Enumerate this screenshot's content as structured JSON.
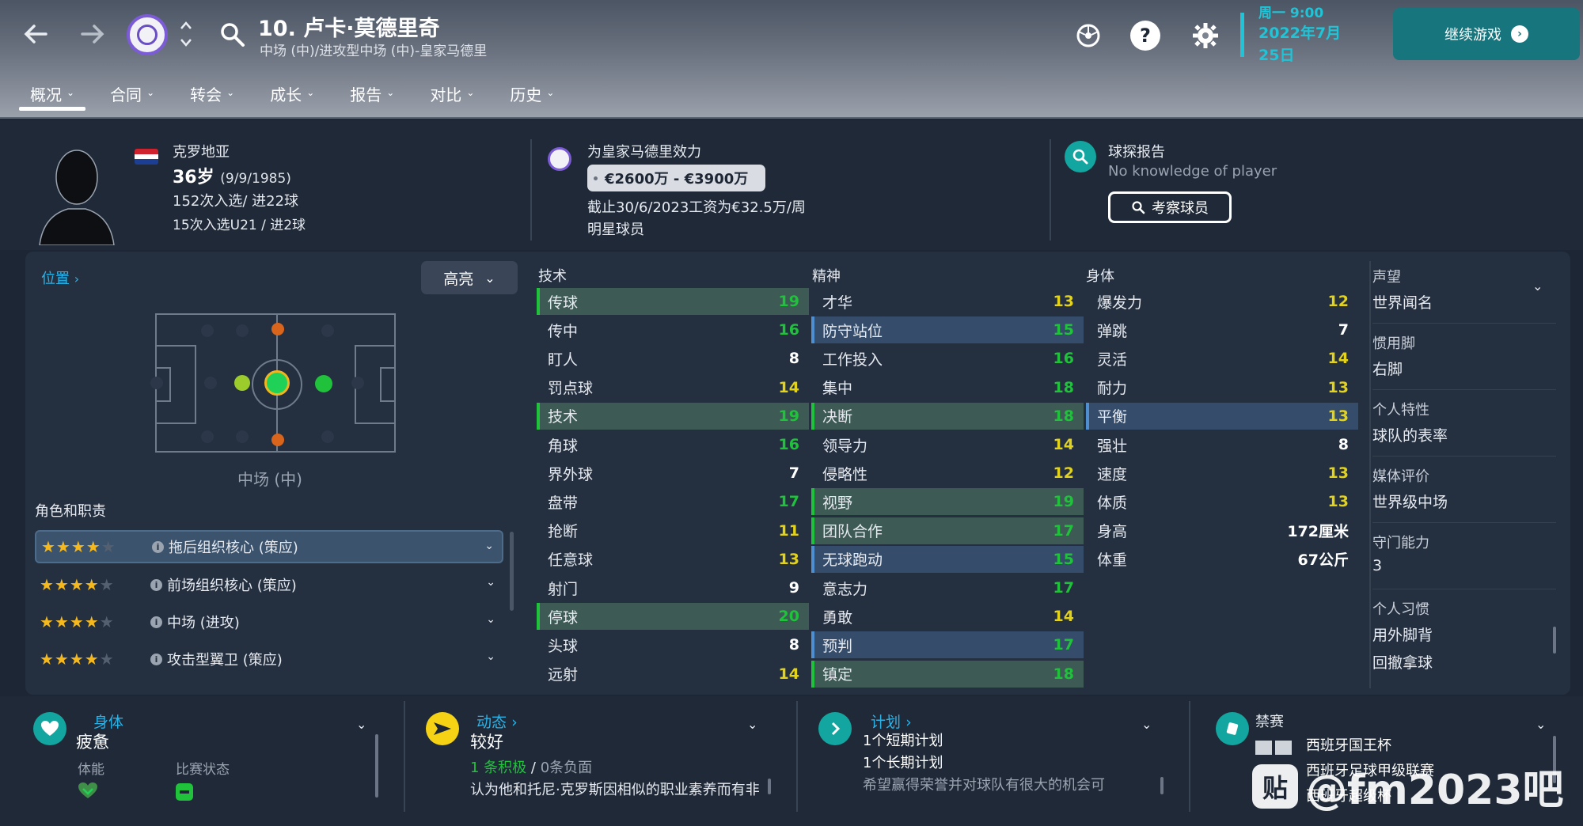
{
  "header": {
    "player_title": "10. 卢卡·莫德里奇",
    "player_subtitle": "中场 (中)/进攻型中场 (中)-皇家马德里",
    "date_top": "周一 9:00",
    "date_main": "2022年7月25日",
    "continue_label": "继续游戏",
    "tabs": [
      {
        "label": "概况"
      },
      {
        "label": "合同"
      },
      {
        "label": "转会"
      },
      {
        "label": "成长"
      },
      {
        "label": "报告"
      },
      {
        "label": "对比"
      },
      {
        "label": "历史"
      }
    ]
  },
  "info": {
    "nationality": "克罗地亚",
    "age": "36岁",
    "dob": "(9/9/1985)",
    "caps": "152次入选/ 进22球",
    "caps_u21": "15次入选U21 / 进2球",
    "plays_for": "为皇家马德里效力",
    "value": "€2600万 - €3900万",
    "wage": "截止30/6/2023工资为€32.5万/周",
    "status": "明星球员",
    "scout_title": "球探报告",
    "scout_note": "No knowledge of player",
    "scout_button": "考察球员"
  },
  "position": {
    "link_label": "位置",
    "highlight_label": "高亮",
    "position_label": "中场 (中)",
    "roles_title": "角色和职责",
    "roles": [
      {
        "name": "拖后组织核心 (策应)",
        "stars": 4
      },
      {
        "name": "前场组织核心 (策应)",
        "stars": 4
      },
      {
        "name": "中场 (进攻)",
        "stars": 4
      },
      {
        "name": "攻击型翼卫 (策应)",
        "stars": 4
      }
    ]
  },
  "attributes": {
    "technical_title": "技术",
    "mental_title": "精神",
    "physical_title": "身体",
    "technical": [
      {
        "name": "传球",
        "value": "19",
        "hl": "green"
      },
      {
        "name": "传中",
        "value": "16",
        "hl": ""
      },
      {
        "name": "盯人",
        "value": "8",
        "hl": ""
      },
      {
        "name": "罚点球",
        "value": "14",
        "hl": ""
      },
      {
        "name": "技术",
        "value": "19",
        "hl": "green"
      },
      {
        "name": "角球",
        "value": "16",
        "hl": ""
      },
      {
        "name": "界外球",
        "value": "7",
        "hl": ""
      },
      {
        "name": "盘带",
        "value": "17",
        "hl": ""
      },
      {
        "name": "抢断",
        "value": "11",
        "hl": ""
      },
      {
        "name": "任意球",
        "value": "13",
        "hl": ""
      },
      {
        "name": "射门",
        "value": "9",
        "hl": ""
      },
      {
        "name": "停球",
        "value": "20",
        "hl": "green"
      },
      {
        "name": "头球",
        "value": "8",
        "hl": ""
      },
      {
        "name": "远射",
        "value": "14",
        "hl": ""
      }
    ],
    "mental": [
      {
        "name": "才华",
        "value": "13",
        "hl": ""
      },
      {
        "name": "防守站位",
        "value": "15",
        "hl": "blue"
      },
      {
        "name": "工作投入",
        "value": "16",
        "hl": ""
      },
      {
        "name": "集中",
        "value": "18",
        "hl": ""
      },
      {
        "name": "决断",
        "value": "18",
        "hl": "green"
      },
      {
        "name": "领导力",
        "value": "14",
        "hl": ""
      },
      {
        "name": "侵略性",
        "value": "12",
        "hl": ""
      },
      {
        "name": "视野",
        "value": "19",
        "hl": "green"
      },
      {
        "name": "团队合作",
        "value": "17",
        "hl": "green"
      },
      {
        "name": "无球跑动",
        "value": "15",
        "hl": "blue"
      },
      {
        "name": "意志力",
        "value": "17",
        "hl": ""
      },
      {
        "name": "勇敢",
        "value": "14",
        "hl": ""
      },
      {
        "name": "预判",
        "value": "17",
        "hl": "blue"
      },
      {
        "name": "镇定",
        "value": "18",
        "hl": "green"
      }
    ],
    "physical": [
      {
        "name": "爆发力",
        "value": "12",
        "hl": ""
      },
      {
        "name": "弹跳",
        "value": "7",
        "hl": ""
      },
      {
        "name": "灵活",
        "value": "14",
        "hl": ""
      },
      {
        "name": "耐力",
        "value": "13",
        "hl": ""
      },
      {
        "name": "平衡",
        "value": "13",
        "hl": "blue"
      },
      {
        "name": "强壮",
        "value": "8",
        "hl": ""
      },
      {
        "name": "速度",
        "value": "13",
        "hl": ""
      },
      {
        "name": "体质",
        "value": "13",
        "hl": ""
      },
      {
        "name": "身高",
        "value": "172厘米",
        "hl": ""
      },
      {
        "name": "体重",
        "value": "67公斤",
        "hl": ""
      }
    ]
  },
  "right_panel": {
    "reputation_label": "声望",
    "reputation_value": "世界闻名",
    "foot_label": "惯用脚",
    "foot_value": "右脚",
    "trait_label": "个人特性",
    "trait_value": "球队的表率",
    "media_label": "媒体评价",
    "media_value": "世界级中场",
    "gk_label": "守门能力",
    "gk_value": "3",
    "habits_label": "个人习惯",
    "habit_1": "用外脚背",
    "habit_2": "回撤拿球"
  },
  "bottom": {
    "physical_title": "身体",
    "physical_main": "疲惫",
    "fitness_label": "体能",
    "match_label": "比赛状态",
    "dynamics_title": "动态",
    "dynamics_main": "较好",
    "dynamics_pos": "1 条积极",
    "dynamics_sep": "/",
    "dynamics_neg": "0条负面",
    "dynamics_text": "认为他和托尼·克罗斯因相似的职业素养而有非",
    "plan_title": "计划",
    "plan_short": "1个短期计划",
    "plan_long": "1个长期计划",
    "plan_text": "希望赢得荣誉并对球队有很大的机会可",
    "ban_title": "禁赛",
    "ban_1": "西班牙国王杯",
    "ban_2": "西班牙足球甲级联赛",
    "ban_3": "西班牙超级杯"
  },
  "watermark": {
    "logo": "贴",
    "text": "@fm2023吧"
  },
  "colors": {
    "accent": "#20c4d6",
    "continue_bg": "#17757d",
    "link": "#2bb3e8",
    "value_green": "#20c23b",
    "value_yellow": "#e3d21a",
    "value_white": "#ffffff",
    "hl_green": "#3d5a54",
    "hl_blue": "#354d6a"
  },
  "icons": [
    "back-arrow-icon",
    "forward-arrow-icon",
    "club-crest-icon",
    "search-icon",
    "ball-icon",
    "help-icon",
    "gear-icon",
    "chevron-right-icon",
    "star-icon",
    "info-icon",
    "heart-icon",
    "arrow-plane-icon",
    "ban-icon"
  ]
}
